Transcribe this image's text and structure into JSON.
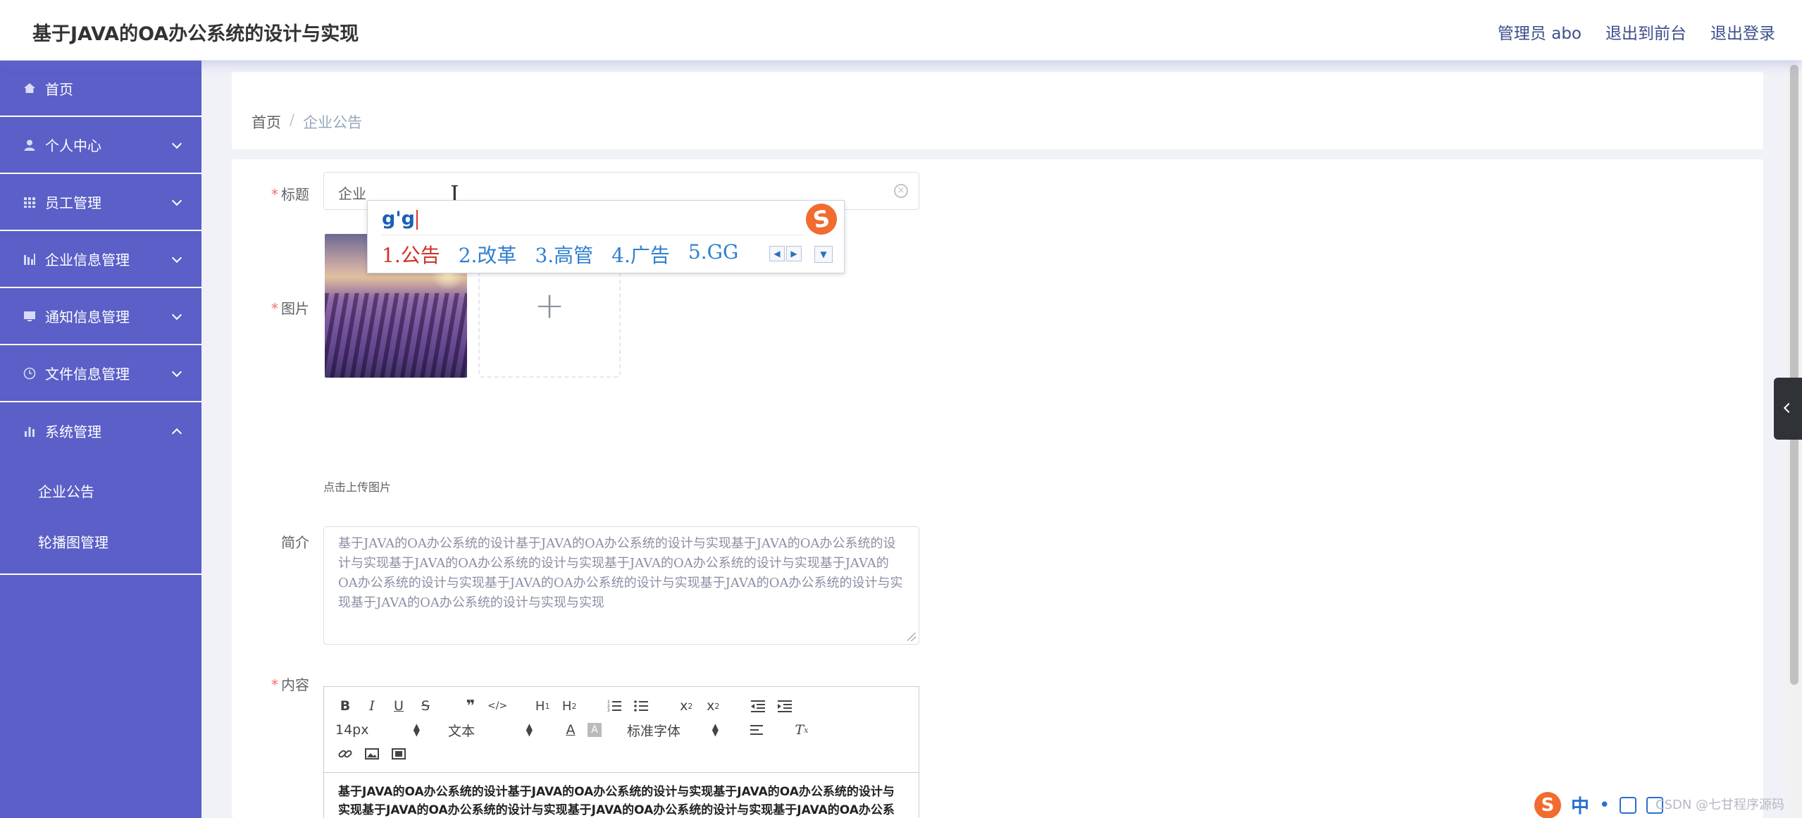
{
  "header": {
    "title": "基于JAVA的OA办公系统的设计与实现",
    "nav": [
      "管理员 abo",
      "退出到前台",
      "退出登录"
    ]
  },
  "sidebar": {
    "items": [
      {
        "label": "首页",
        "icon": "home-icon"
      },
      {
        "label": "个人中心",
        "icon": "user-icon"
      },
      {
        "label": "员工管理",
        "icon": "grid-icon"
      },
      {
        "label": "企业信息管理",
        "icon": "bar-chart-icon"
      },
      {
        "label": "通知信息管理",
        "icon": "monitor-icon"
      },
      {
        "label": "文件信息管理",
        "icon": "clock-icon"
      },
      {
        "label": "系统管理",
        "icon": "stats-icon"
      }
    ],
    "submenu": [
      "企业公告",
      "轮播图管理"
    ]
  },
  "breadcrumb": {
    "home": "首页",
    "sep": "/",
    "current": "企业公告"
  },
  "form": {
    "title_label": "标题",
    "title_value": "企业",
    "image_label": "图片",
    "upload_hint": "点击上传图片",
    "intro_label": "简介",
    "intro_value": "基于JAVA的OA办公系统的设计基于JAVA的OA办公系统的设计与实现基于JAVA的OA办公系统的设计与实现基于JAVA的OA办公系统的设计与实现基于JAVA的OA办公系统的设计与实现基于JAVA的OA办公系统的设计与实现基于JAVA的OA办公系统的设计与实现基于JAVA的OA办公系统的设计与实现基于JAVA的OA办公系统的设计与实现与实现",
    "content_label": "内容",
    "editor": {
      "font_size": "14px",
      "text_type": "文本",
      "font_family": "标准字体",
      "body": "基于JAVA的OA办公系统的设计基于JAVA的OA办公系统的设计与实现基于JAVA的OA办公系统的设计与实现基于JAVA的OA办公系统的设计与实现基于JAVA的OA办公系统的设计与实现基于JAVA的OA办公系统的设计与实现基于JAVA的OA办公系统的设计与实现基于JAVA的OA办公系统的设计与实现基于JAVA的OA办公系统的设计与实现基于JAVA的OA办公系统的设计基于JAVA的OA办公系统的设计与实现基于JAVA的OA办公系统的设计与实现基于JAVA的OA办公系统的设计与实现"
    }
  },
  "ime": {
    "pinyin": "g'g",
    "candidates": [
      "1.公告",
      "2.改革",
      "3.高管",
      "4.广告",
      "5.GG"
    ]
  },
  "tray": {
    "zh": "中",
    "watermark": "CSDN @七甘程序源码"
  }
}
